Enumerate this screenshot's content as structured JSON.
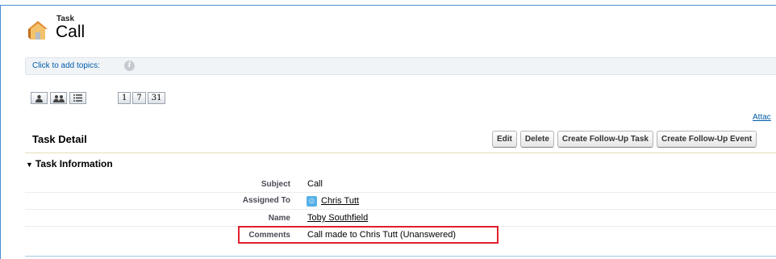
{
  "header": {
    "record_type": "Task",
    "record_name": "Call"
  },
  "topics": {
    "link_label": "Click to add topics:",
    "info_icon": "info-icon"
  },
  "view_buttons": [
    {
      "icon": "single-user-icon"
    },
    {
      "icon": "multi-user-icon"
    },
    {
      "icon": "list-view-icon"
    }
  ],
  "calendar_buttons": [
    {
      "label": "1"
    },
    {
      "label": "7"
    },
    {
      "label": "31"
    }
  ],
  "attachments_link": "Attac",
  "detail": {
    "title": "Task Detail",
    "buttons": {
      "edit": "Edit",
      "delete": "Delete",
      "follow_task": "Create Follow-Up Task",
      "follow_event": "Create Follow-Up Event"
    }
  },
  "section": {
    "title": "Task Information",
    "toggle_icon": "triangle-down-icon"
  },
  "fields": {
    "subject": {
      "label": "Subject",
      "value": "Call"
    },
    "assigned_to": {
      "label": "Assigned To",
      "value": "Chris Tutt",
      "icon": "contact-icon"
    },
    "name": {
      "label": "Name",
      "value": "Toby Southfield"
    },
    "comments": {
      "label": "Comments",
      "value": "Call made to Chris Tutt (Unanswered)"
    }
  },
  "colors": {
    "accent_border": "#4d8fd6",
    "link": "#015ba7",
    "highlight": "#e0202b"
  }
}
